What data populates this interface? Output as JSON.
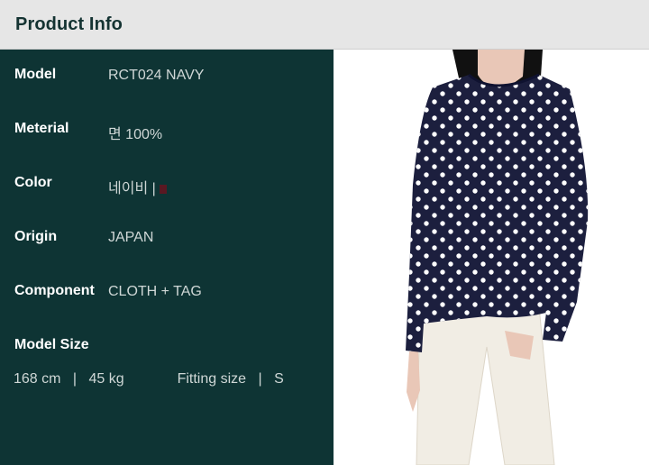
{
  "header": {
    "title": "Product Info"
  },
  "info": {
    "rows": [
      {
        "label": "Model",
        "value": "RCT024 NAVY"
      },
      {
        "label": "Meterial",
        "value": "면 100%"
      },
      {
        "label": "Color",
        "value": "네이비 |"
      },
      {
        "label": "Origin",
        "value": "JAPAN"
      },
      {
        "label": "Component",
        "value": "CLOTH + TAG"
      },
      {
        "label": "Model Size",
        "value": ""
      }
    ],
    "color_swatch": "#5a1822",
    "model_size": {
      "height": "168 cm",
      "weight": "45 kg",
      "fitting_label": "Fitting size",
      "fitting_value": "S",
      "divider": "|"
    }
  },
  "photo": {
    "subject": "product-model-photo",
    "shirt_color": "#1c1f3e",
    "dot_color": "#ffffff",
    "pants_color": "#f1ede4"
  }
}
